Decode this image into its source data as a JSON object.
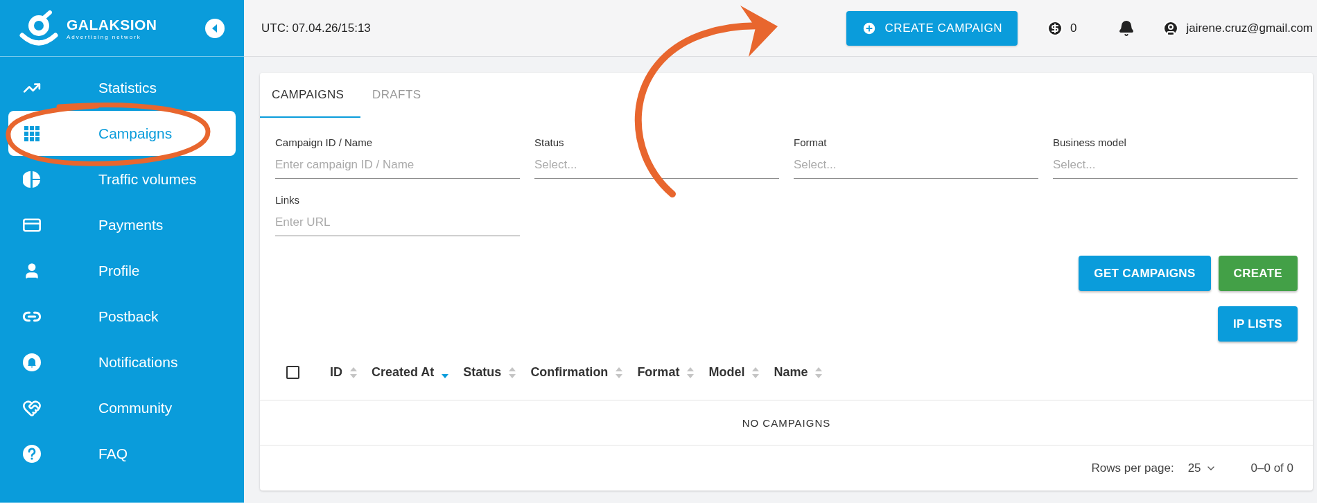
{
  "sidebar": {
    "logo": {
      "name": "GALAKSION",
      "tagline": "Advertising network"
    },
    "items": [
      {
        "label": "Statistics",
        "selected": false
      },
      {
        "label": "Campaigns",
        "selected": true
      },
      {
        "label": "Traffic volumes",
        "selected": false
      },
      {
        "label": "Payments",
        "selected": false
      },
      {
        "label": "Profile",
        "selected": false
      },
      {
        "label": "Postback",
        "selected": false
      },
      {
        "label": "Notifications",
        "selected": false
      },
      {
        "label": "Community",
        "selected": false
      },
      {
        "label": "FAQ",
        "selected": false
      }
    ]
  },
  "header": {
    "utc": "UTC: 07.04.26/15:13",
    "create_button": "CREATE CAMPAIGN",
    "balance": "0",
    "email": "jairene.cruz@gmail.com"
  },
  "tabs": [
    {
      "label": "CAMPAIGNS",
      "selected": true
    },
    {
      "label": "DRAFTS",
      "selected": false
    }
  ],
  "filters": [
    {
      "label": "Campaign ID / Name",
      "placeholder": "Enter campaign ID / Name"
    },
    {
      "label": "Status",
      "placeholder": "Select..."
    },
    {
      "label": "Format",
      "placeholder": "Select..."
    },
    {
      "label": "Business model",
      "placeholder": "Select..."
    },
    {
      "label": "Links",
      "placeholder": "Enter URL"
    }
  ],
  "buttons": [
    {
      "label": "GET CAMPAIGNS",
      "kind": "primary"
    },
    {
      "label": "CREATE",
      "kind": "success"
    },
    {
      "label": "IP LISTS",
      "kind": "primary"
    }
  ],
  "table": {
    "select_all_checked": false,
    "columns": [
      {
        "label": "ID",
        "sorted": false
      },
      {
        "label": "Created At",
        "sorted": true
      },
      {
        "label": "Status",
        "sorted": false
      },
      {
        "label": "Confirmation",
        "sorted": false
      },
      {
        "label": "Format",
        "sorted": false
      },
      {
        "label": "Model",
        "sorted": false
      },
      {
        "label": "Name",
        "sorted": false
      }
    ],
    "empty_message": "NO CAMPAIGNS"
  },
  "pagination": {
    "label": "Rows per page:",
    "rows": "25",
    "range": "0–0 of 0"
  }
}
